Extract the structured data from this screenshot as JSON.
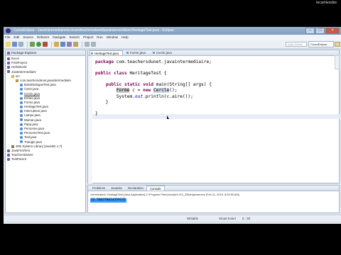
{
  "camera_label": "tecamlessbis",
  "window": {
    "title": "CursoEclipse - JavaIntermediaire/src/com/teachersdunet/javaintermediaire/HeritageTest.java - Eclipse"
  },
  "menu": [
    "File",
    "Edit",
    "Source",
    "Refactor",
    "Navigate",
    "Search",
    "Project",
    "Run",
    "Window",
    "Help"
  ],
  "toolbar": {
    "quick_access_placeholder": "Quick Access",
    "perspective_label": "CursoEclipse"
  },
  "package_explorer": {
    "tab_label": "Package Explorer",
    "items": [
      {
        "label": "Excel",
        "indent": 0,
        "icon": "proj"
      },
      {
        "label": "FirstProject",
        "indent": 0,
        "icon": "proj"
      },
      {
        "label": "HelloWorld",
        "indent": 0,
        "icon": "proj"
      },
      {
        "label": "JavaIntermediaire",
        "indent": 0,
        "icon": "proj"
      },
      {
        "label": "src",
        "indent": 1,
        "icon": "src"
      },
      {
        "label": "com.teachersdunet.javaintermediaire",
        "indent": 2,
        "icon": "pkgi"
      },
      {
        "label": "BoiteDialogueTest.java",
        "indent": 3,
        "icon": "java"
      },
      {
        "label": "Carre.java",
        "indent": 3,
        "icon": "java"
      },
      {
        "label": "Cercle.java",
        "indent": 3,
        "icon": "java",
        "underline": true
      },
      {
        "label": "Enfant.java",
        "indent": 3,
        "icon": "java"
      },
      {
        "label": "Forme.java",
        "indent": 3,
        "icon": "java"
      },
      {
        "label": "HeritageTest.java",
        "indent": 3,
        "icon": "java"
      },
      {
        "label": "Interrupteur.java",
        "indent": 3,
        "icon": "java"
      },
      {
        "label": "Lampe.java",
        "indent": 3,
        "icon": "java"
      },
      {
        "label": "Maman.java",
        "indent": 3,
        "icon": "java"
      },
      {
        "label": "Papa.java",
        "indent": 3,
        "icon": "java"
      },
      {
        "label": "Personne.java",
        "indent": 3,
        "icon": "java"
      },
      {
        "label": "PersonneTest.java",
        "indent": 3,
        "icon": "java"
      },
      {
        "label": "Test.java",
        "indent": 3,
        "icon": "java"
      },
      {
        "label": "Triangle.java",
        "indent": 3,
        "icon": "java"
      },
      {
        "label": "JRE System Library [JavaSE-1.7]",
        "indent": 1,
        "icon": "lib"
      },
      {
        "label": "JavaFirstTest",
        "indent": 0,
        "icon": "proj"
      },
      {
        "label": "TeachersDuNet",
        "indent": 0,
        "icon": "proj"
      },
      {
        "label": "TestParent",
        "indent": 0,
        "icon": "proj"
      }
    ]
  },
  "editor": {
    "tabs": [
      "HeritageTest.java",
      "Forme.java",
      "Cercle.java"
    ],
    "active_tab": 0,
    "code": {
      "l1_kw": "package",
      "l1_rest": " com.teachersdunet.javaintermediaire;",
      "l3_kw1": "public",
      "l3_kw2": "class",
      "l3_rest": " HeritageTest {",
      "l5_kw1": "public",
      "l5_kw2": "static",
      "l5_kw3": "void",
      "l5_rest": " main(String[] args) {",
      "l6_type": "Forme",
      "l6_mid": " c = ",
      "l6_new": "new",
      "l6_ctor": "Cercle",
      "l6_end": "();",
      "l7_a": "System.",
      "l7_out": "out",
      "l7_b": ".println(c.aire());",
      "l8": "}",
      "l10": "}"
    }
  },
  "bottom": {
    "tabs": [
      "Problems",
      "Javadoc",
      "Declaration",
      "Console"
    ],
    "active_tab": 3,
    "console_header": "<terminated> HeritageTest [Java Application] C:\\Program Files\\Java\\jre1.8.0_25\\bin\\javaw.exe (Feb 11, 2015, 8:25:50 AM)",
    "console_output": "12.566370614359172"
  },
  "status": {
    "writable": "Writable",
    "insert_mode": "Smart Insert",
    "position": "6 : 28"
  },
  "colors": {
    "keyword": "#7f0055",
    "field": "#0000c0",
    "selection": "#3399ff"
  }
}
